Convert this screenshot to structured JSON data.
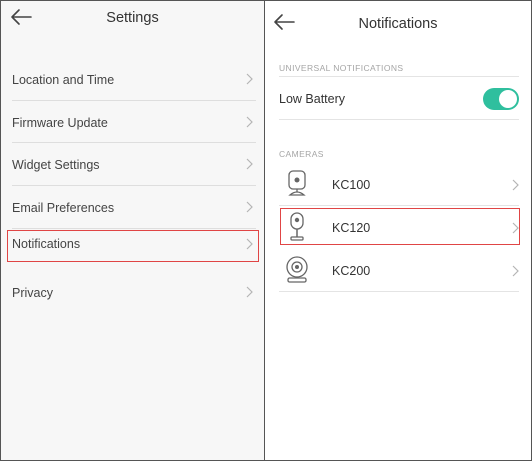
{
  "settings": {
    "title": "Settings",
    "back_icon": "arrow-left-icon",
    "items": [
      {
        "label": "Location and Time"
      },
      {
        "label": "Firmware Update"
      },
      {
        "label": "Widget Settings"
      },
      {
        "label": "Email Preferences"
      },
      {
        "label": "Notifications",
        "highlighted": true
      },
      {
        "label": "Privacy"
      }
    ]
  },
  "notifications": {
    "title": "Notifications",
    "back_icon": "arrow-left-icon",
    "universal_section": "UNIVERSAL NOTIFICATIONS",
    "low_battery": {
      "label": "Low Battery",
      "enabled": true
    },
    "cameras_section": "CAMERAS",
    "cameras": [
      {
        "label": "KC100",
        "icon": "camera-kc100-icon"
      },
      {
        "label": "KC120",
        "icon": "camera-kc120-icon",
        "highlighted": true
      },
      {
        "label": "KC200",
        "icon": "camera-kc200-icon"
      }
    ]
  },
  "colors": {
    "toggle_on": "#2fbf9e",
    "highlight_outline": "#e04545"
  }
}
